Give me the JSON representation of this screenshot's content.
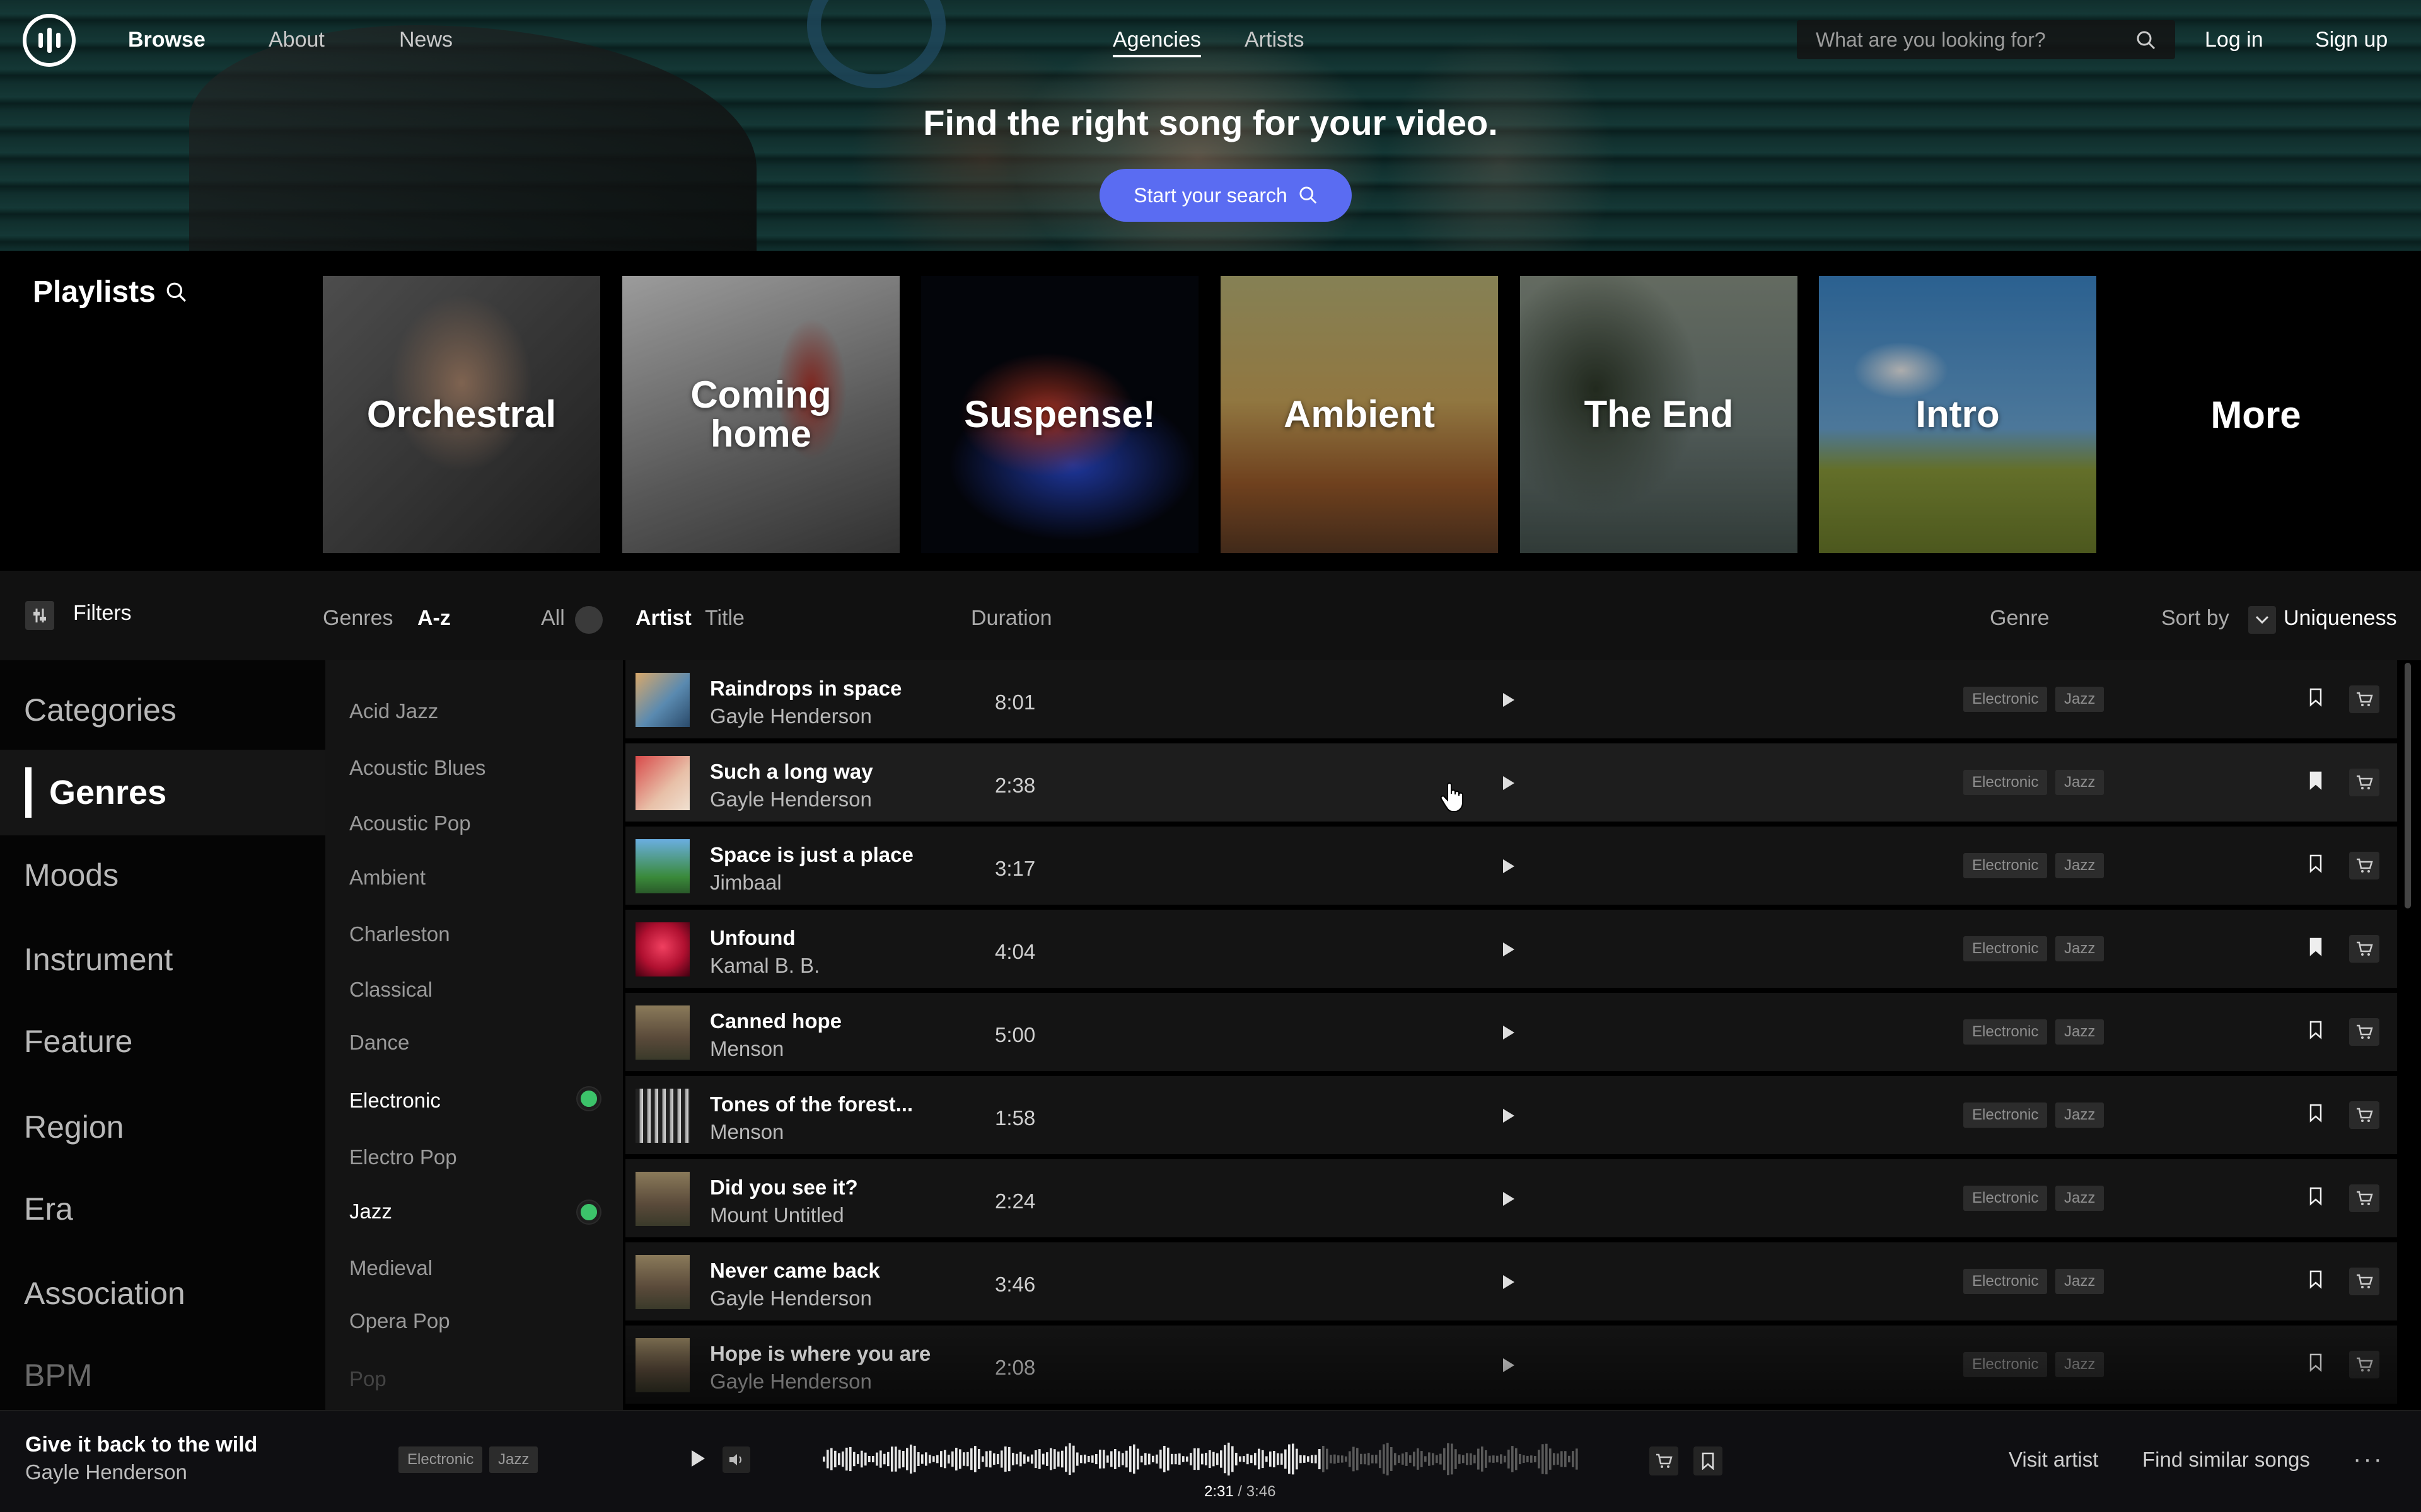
{
  "nav": {
    "links": [
      "Browse",
      "About",
      "News"
    ],
    "center_links": [
      "Agencies",
      "Artists"
    ],
    "search_placeholder": "What are you looking for?",
    "login": "Log in",
    "signup": "Sign up"
  },
  "hero": {
    "title": "Find the right song for your video.",
    "cta": "Start your search"
  },
  "playlists": {
    "title": "Playlists",
    "items": [
      "Orchestral",
      "Coming home",
      "Suspense!",
      "Ambient",
      "The End",
      "Intro"
    ],
    "more": "More"
  },
  "filterbar": {
    "filters": "Filters",
    "genres": "Genres",
    "az": "A-z",
    "all": "All",
    "artist": "Artist",
    "title": "Title",
    "duration": "Duration",
    "genre": "Genre",
    "sort_by": "Sort by",
    "sort_value": "Uniqueness"
  },
  "categories": [
    "Categories",
    "Genres",
    "Moods",
    "Instrument",
    "Feature",
    "Region",
    "Era",
    "Association",
    "BPM"
  ],
  "genres": [
    "Acid Jazz",
    "Acoustic Blues",
    "Acoustic Pop",
    "Ambient",
    "Charleston",
    "Classical",
    "Dance",
    "Electronic",
    "Electro Pop",
    "Jazz",
    "Medieval",
    "Opera Pop",
    "Pop"
  ],
  "selected_genres": [
    "Electronic",
    "Jazz"
  ],
  "tracks": [
    {
      "title": "Raindrops in space",
      "artist": "Gayle Henderson",
      "duration": "8:01",
      "tags": [
        "Electronic",
        "Jazz"
      ],
      "bookmarked": false
    },
    {
      "title": "Such a long way",
      "artist": "Gayle Henderson",
      "duration": "2:38",
      "tags": [
        "Electronic",
        "Jazz"
      ],
      "bookmarked": true
    },
    {
      "title": "Space is just a place",
      "artist": "Jimbaal",
      "duration": "3:17",
      "tags": [
        "Electronic",
        "Jazz"
      ],
      "bookmarked": false
    },
    {
      "title": "Unfound",
      "artist": "Kamal B. B.",
      "duration": "4:04",
      "tags": [
        "Electronic",
        "Jazz"
      ],
      "bookmarked": true
    },
    {
      "title": "Canned hope",
      "artist": "Menson",
      "duration": "5:00",
      "tags": [
        "Electronic",
        "Jazz"
      ],
      "bookmarked": false
    },
    {
      "title": "Tones of the forest...",
      "artist": "Menson",
      "duration": "1:58",
      "tags": [
        "Electronic",
        "Jazz"
      ],
      "bookmarked": false
    },
    {
      "title": "Did you see it?",
      "artist": "Mount Untitled",
      "duration": "2:24",
      "tags": [
        "Electronic",
        "Jazz"
      ],
      "bookmarked": false
    },
    {
      "title": "Never came back",
      "artist": "Gayle Henderson",
      "duration": "3:46",
      "tags": [
        "Electronic",
        "Jazz"
      ],
      "bookmarked": false
    },
    {
      "title": "Hope is where you are",
      "artist": "Gayle Henderson",
      "duration": "2:08",
      "tags": [
        "Electronic",
        "Jazz"
      ],
      "bookmarked": false
    }
  ],
  "player": {
    "title": "Give it back to the wild",
    "artist": "Gayle Henderson",
    "tags": [
      "Electronic",
      "Jazz"
    ],
    "time_current": "2:31",
    "time_total": "3:46",
    "progress": 0.66,
    "visit_artist": "Visit artist",
    "find_similar": "Find similar songs"
  },
  "colors": {
    "accent": "#5a6cf2",
    "selected_dot": "#3cc36a",
    "background": "#000000"
  }
}
